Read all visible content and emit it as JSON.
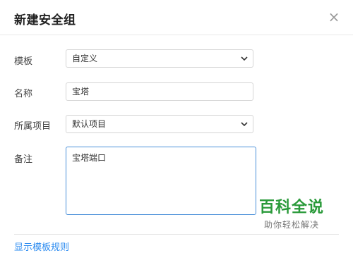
{
  "dialog": {
    "title": "新建安全组",
    "close_glyph": "×"
  },
  "form": {
    "template": {
      "label": "模板",
      "value": "自定义"
    },
    "name": {
      "label": "名称",
      "value": "宝塔"
    },
    "project": {
      "label": "所属项目",
      "value": "默认项目"
    },
    "remark": {
      "label": "备注",
      "value": "宝塔端口"
    }
  },
  "footer": {
    "link_label": "显示模板规则"
  },
  "watermark": {
    "main": "百科全说",
    "sub": "助你轻松解决"
  },
  "colors": {
    "accent": "#2d8cf0",
    "focus_border": "#4a90d9",
    "watermark_green": "#2a9a3a"
  }
}
